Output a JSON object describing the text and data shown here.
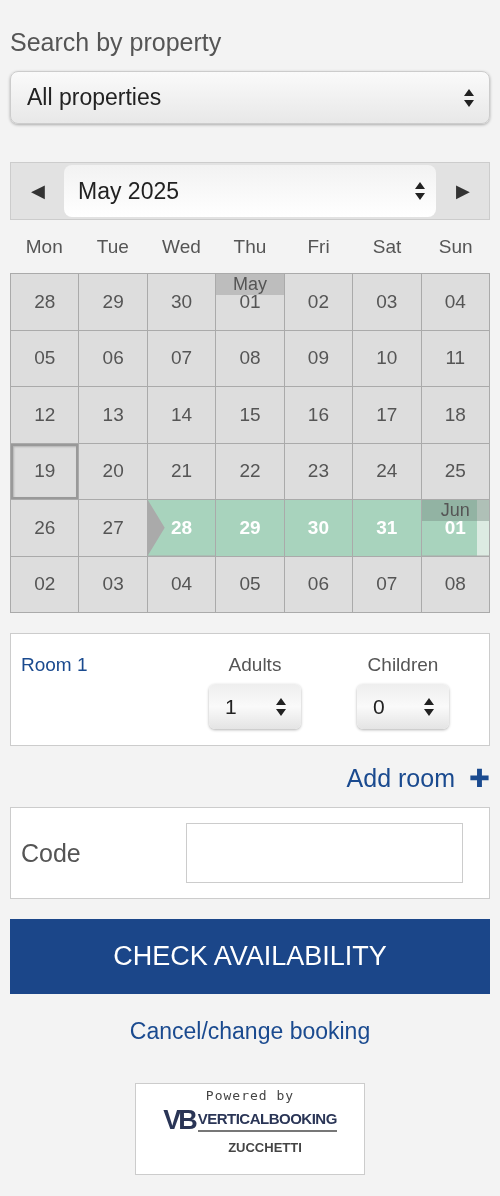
{
  "property_search": {
    "label": "Search by property",
    "value": "All properties"
  },
  "calendar": {
    "prev": "◀",
    "next": "▶",
    "month_select": "May 2025",
    "weekdays": [
      "Mon",
      "Tue",
      "Wed",
      "Thu",
      "Fri",
      "Sat",
      "Sun"
    ],
    "days": [
      {
        "day": "28",
        "selected": false,
        "kind": "day"
      },
      {
        "day": "29",
        "selected": false,
        "kind": "day"
      },
      {
        "day": "30",
        "selected": false,
        "kind": "day"
      },
      {
        "day": "01",
        "month": "May",
        "selected": false,
        "kind": "day"
      },
      {
        "day": "02",
        "selected": false,
        "kind": "day"
      },
      {
        "day": "03",
        "selected": false,
        "kind": "day"
      },
      {
        "day": "04",
        "selected": false,
        "kind": "day"
      },
      {
        "day": "05",
        "selected": false,
        "kind": "day"
      },
      {
        "day": "06",
        "selected": false,
        "kind": "day"
      },
      {
        "day": "07",
        "selected": false,
        "kind": "day"
      },
      {
        "day": "08",
        "selected": false,
        "kind": "day"
      },
      {
        "day": "09",
        "selected": false,
        "kind": "day"
      },
      {
        "day": "10",
        "selected": false,
        "kind": "day"
      },
      {
        "day": "11",
        "selected": false,
        "kind": "day"
      },
      {
        "day": "12",
        "selected": false,
        "kind": "day"
      },
      {
        "day": "13",
        "selected": false,
        "kind": "day"
      },
      {
        "day": "14",
        "selected": false,
        "kind": "day"
      },
      {
        "day": "15",
        "selected": false,
        "kind": "day"
      },
      {
        "day": "16",
        "selected": false,
        "kind": "day"
      },
      {
        "day": "17",
        "selected": false,
        "kind": "day"
      },
      {
        "day": "18",
        "selected": false,
        "kind": "day"
      },
      {
        "day": "19",
        "selected": false,
        "kind": "today"
      },
      {
        "day": "20",
        "selected": false,
        "kind": "day"
      },
      {
        "day": "21",
        "selected": false,
        "kind": "day"
      },
      {
        "day": "22",
        "selected": false,
        "kind": "day"
      },
      {
        "day": "23",
        "selected": false,
        "kind": "day"
      },
      {
        "day": "24",
        "selected": false,
        "kind": "day"
      },
      {
        "day": "25",
        "selected": false,
        "kind": "day"
      },
      {
        "day": "26",
        "selected": false,
        "kind": "day"
      },
      {
        "day": "27",
        "selected": false,
        "kind": "day"
      },
      {
        "day": "28",
        "selected": true,
        "kind": "start"
      },
      {
        "day": "29",
        "selected": true,
        "kind": "day"
      },
      {
        "day": "30",
        "selected": true,
        "kind": "day"
      },
      {
        "day": "31",
        "selected": true,
        "kind": "day"
      },
      {
        "day": "01",
        "month": "Jun",
        "selected": true,
        "kind": "end"
      },
      {
        "day": "02",
        "selected": false,
        "kind": "day"
      },
      {
        "day": "03",
        "selected": false,
        "kind": "day"
      },
      {
        "day": "04",
        "selected": false,
        "kind": "day"
      },
      {
        "day": "05",
        "selected": false,
        "kind": "day"
      },
      {
        "day": "06",
        "selected": false,
        "kind": "day"
      },
      {
        "day": "07",
        "selected": false,
        "kind": "day"
      },
      {
        "day": "08",
        "selected": false,
        "kind": "day"
      }
    ]
  },
  "rooms": [
    {
      "label": "Room 1",
      "adults_label": "Adults",
      "adults": "1",
      "children_label": "Children",
      "children": "0"
    }
  ],
  "add_room": {
    "label": "Add room",
    "icon": "✚"
  },
  "code": {
    "label": "Code"
  },
  "check_button": "CHECK AVAILABILITY",
  "cancel_link": "Cancel/change booking",
  "footer_logo": {
    "powered": "Powered by",
    "mark": "VB",
    "brand": "VERTICALBOOKING",
    "company": "ZUCCHETTI"
  }
}
